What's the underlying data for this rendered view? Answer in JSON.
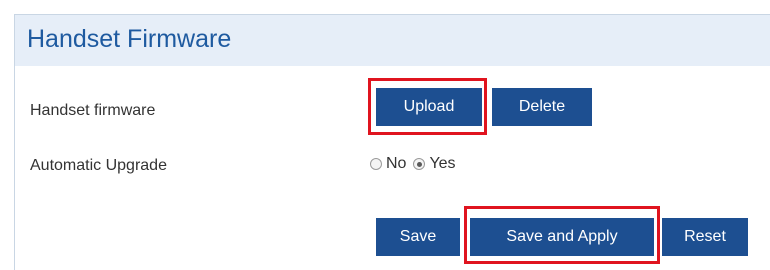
{
  "panel": {
    "title": "Handset Firmware"
  },
  "rows": {
    "handset_firmware_label": "Handset firmware",
    "automatic_upgrade_label": "Automatic Upgrade"
  },
  "buttons": {
    "upload": "Upload",
    "delete": "Delete",
    "save": "Save",
    "save_and_apply": "Save and Apply",
    "reset": "Reset"
  },
  "automatic_upgrade": {
    "options": [
      "No",
      "Yes"
    ],
    "selected": "Yes"
  },
  "colors": {
    "button_bg": "#1d4f91",
    "title": "#1e5aa0",
    "header_bg": "#e6eef8",
    "highlight": "#e0141f"
  }
}
